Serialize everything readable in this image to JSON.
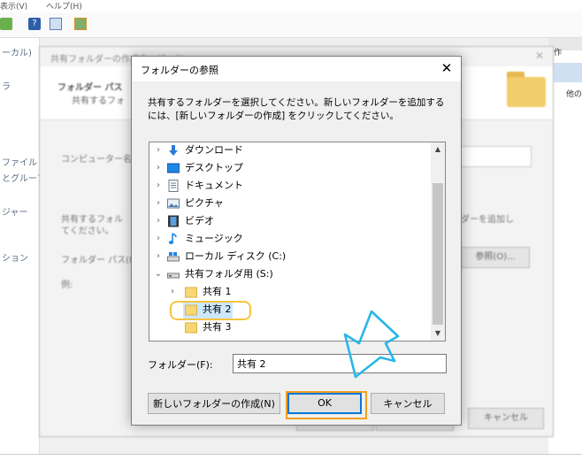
{
  "background": {
    "menu": [
      "表示(V)",
      "ヘルプ(H)"
    ],
    "left_nav": [
      "ーカル)",
      "ラ",
      "ファイル",
      "とグルーフ",
      "ジャー",
      "ション"
    ],
    "right_pane": [
      "作",
      "他の"
    ],
    "wizard": {
      "title": "共有フォルダーの作成ウィザード",
      "header_title": "フォルダー パス",
      "header_sub": "共有するフォ",
      "computer_label": "コンピューター名(C",
      "desc_line1": "共有するフォル",
      "desc_line2": "てください。",
      "desc_right": "ダーを追加し",
      "path_label": "フォルダー パス(F):",
      "example_label": "例:",
      "browse_button": "参照(O)...",
      "cancel_button": "キャンセル"
    }
  },
  "dialog": {
    "title": "フォルダーの参照",
    "close": "✕",
    "description": "共有するフォルダーを選択してください。新しいフォルダーを追加するには、[新しいフォルダーの作成] をクリックしてください。",
    "tree": [
      {
        "label": "ダウンロード",
        "icon": "download-arrow-icon",
        "expander": "›"
      },
      {
        "label": "デスクトップ",
        "icon": "desktop-icon",
        "expander": "›"
      },
      {
        "label": "ドキュメント",
        "icon": "document-icon",
        "expander": "›"
      },
      {
        "label": "ピクチャ",
        "icon": "pictures-icon",
        "expander": "›"
      },
      {
        "label": "ビデオ",
        "icon": "video-icon",
        "expander": "›"
      },
      {
        "label": "ミュージック",
        "icon": "music-icon",
        "expander": "›"
      },
      {
        "label": "ローカル ディスク (C:)",
        "icon": "drive-c-icon",
        "expander": "›"
      },
      {
        "label": "共有フォルダ用 (S:)",
        "icon": "drive-s-icon",
        "expander": "⌄"
      },
      {
        "label": "共有 1",
        "icon": "folder-icon",
        "expander": "›"
      },
      {
        "label": "共有 2",
        "icon": "folder-icon",
        "expander": ""
      },
      {
        "label": "共有 3",
        "icon": "folder-icon",
        "expander": ""
      }
    ],
    "folder_label": "フォルダー(F):",
    "folder_value": "共有 2",
    "new_folder_button": "新しいフォルダーの作成(N)",
    "ok_button": "OK",
    "cancel_button": "キャンセル"
  },
  "colors": {
    "accent": "#0078d7",
    "highlight_ring": "#f5c542",
    "annotation_arrow": "#29b6e8",
    "folder": "#f2cd6c"
  }
}
